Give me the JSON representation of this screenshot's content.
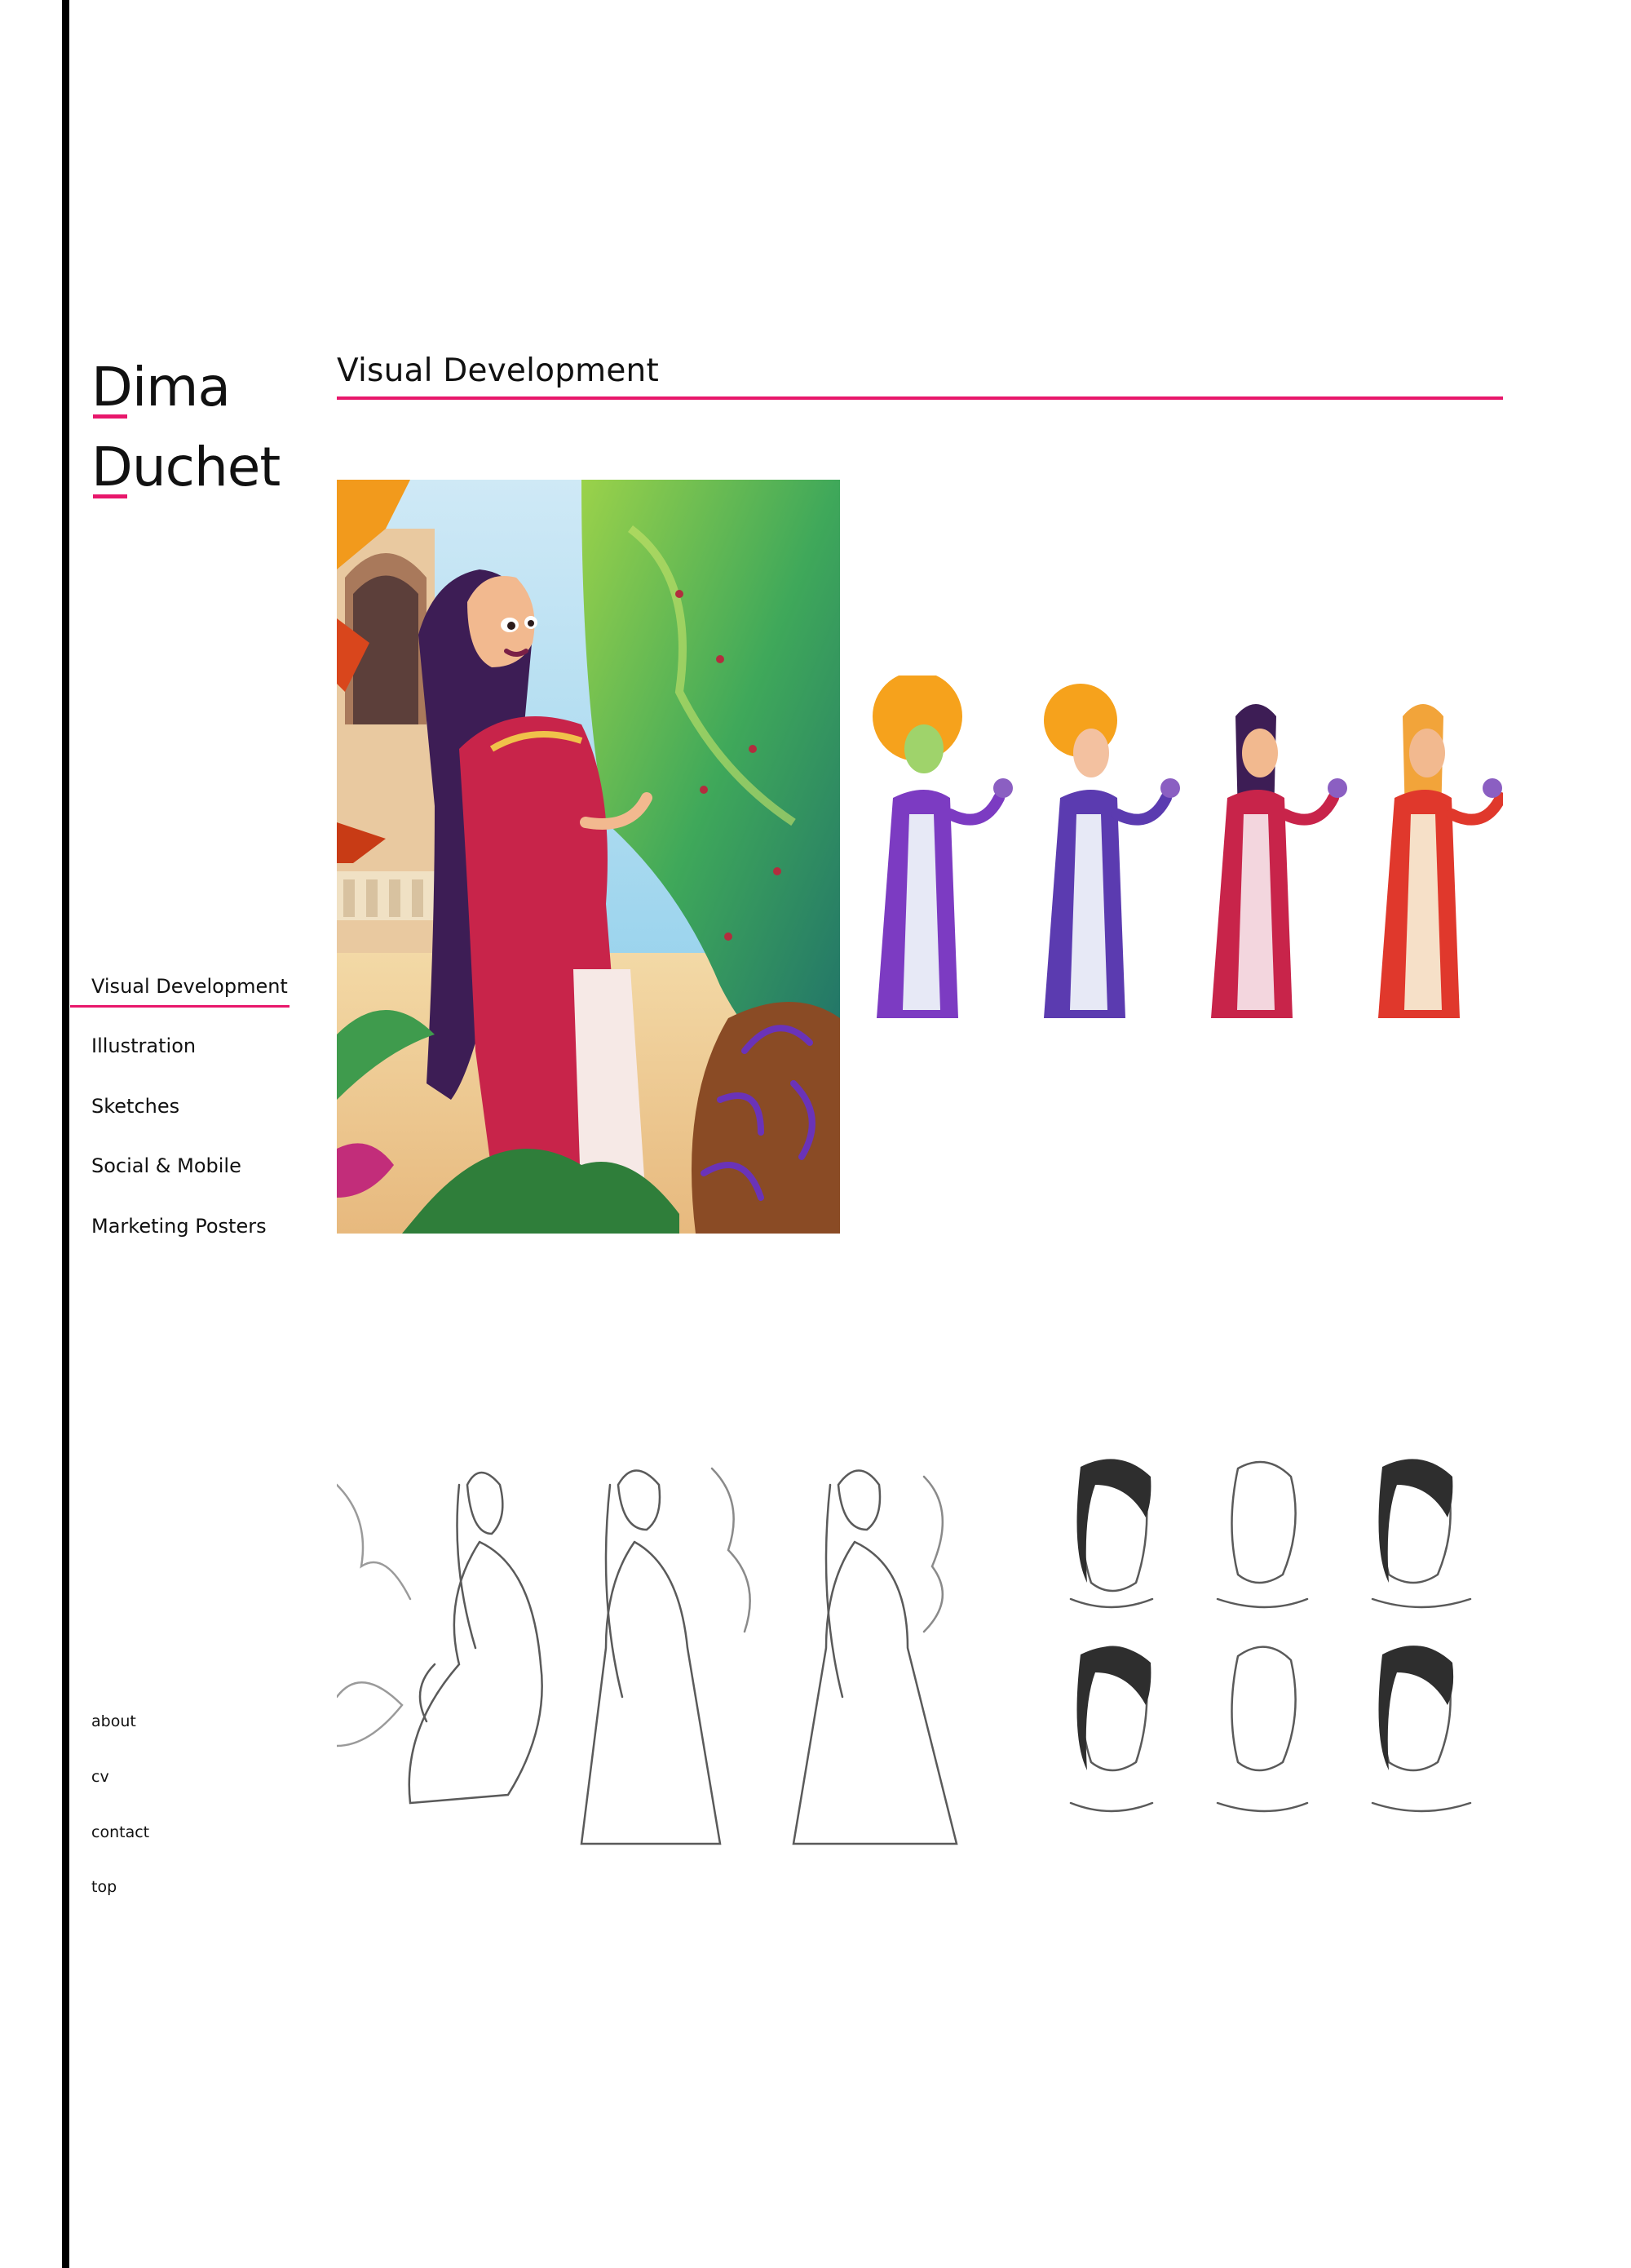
{
  "site": {
    "first_name": "Dima",
    "last_name": "Duchet",
    "accent_color": "#e8176b"
  },
  "nav": {
    "items": [
      {
        "label": "Visual Development",
        "active": true
      },
      {
        "label": "Illustration"
      },
      {
        "label": "Sketches"
      },
      {
        "label": "Social & Mobile"
      },
      {
        "label": "Marketing Posters"
      }
    ]
  },
  "footer": {
    "links": [
      "about",
      "cv",
      "contact",
      "top"
    ]
  },
  "main": {
    "title": "Visual Development",
    "gallery": [
      "princess-garden-painting",
      "princess-color-variations",
      "princess-pencil-sketches"
    ]
  }
}
